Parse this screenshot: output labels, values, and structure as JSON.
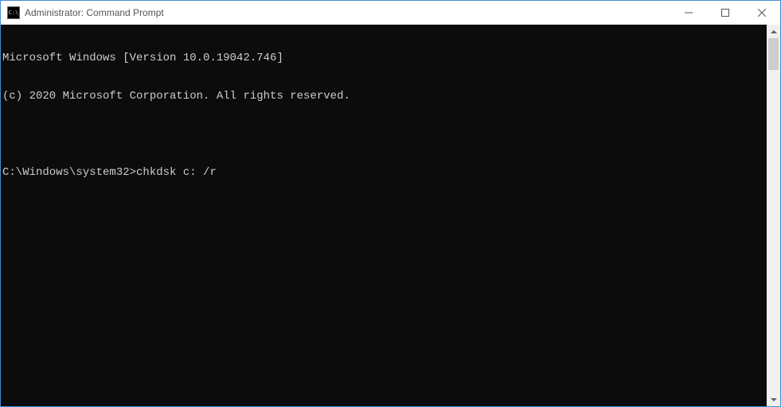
{
  "window": {
    "icon_text": "C:\\",
    "title": "Administrator: Command Prompt"
  },
  "terminal": {
    "lines": [
      "Microsoft Windows [Version 10.0.19042.746]",
      "(c) 2020 Microsoft Corporation. All rights reserved.",
      "",
      ""
    ],
    "prompt": "C:\\Windows\\system32>",
    "command": "chkdsk c: /r"
  }
}
